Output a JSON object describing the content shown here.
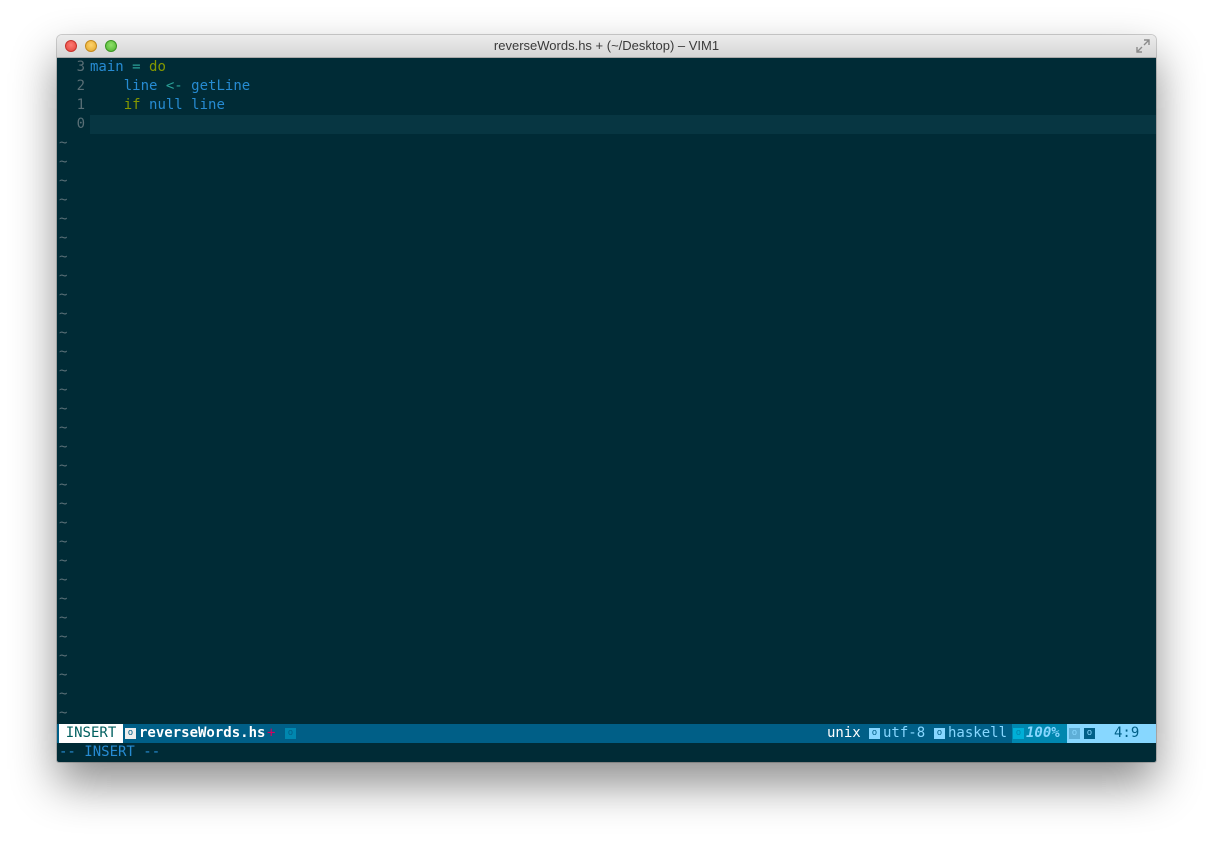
{
  "window": {
    "title": "reverseWords.hs + (~/Desktop) – VIM1"
  },
  "editor": {
    "lines": [
      {
        "num": "3",
        "tokens": [
          [
            "main",
            "kw-main"
          ],
          [
            " ",
            ""
          ],
          [
            "=",
            "kw-op"
          ],
          [
            " ",
            ""
          ],
          [
            "do",
            "kw-do"
          ]
        ]
      },
      {
        "num": "2",
        "tokens": [
          [
            "    ",
            ""
          ],
          [
            "line",
            "kw-ident"
          ],
          [
            " ",
            ""
          ],
          [
            "<-",
            "kw-op"
          ],
          [
            " ",
            ""
          ],
          [
            "getLine",
            "kw-ident"
          ]
        ]
      },
      {
        "num": "1",
        "tokens": [
          [
            "    ",
            ""
          ],
          [
            "if",
            "kw-if"
          ],
          [
            " ",
            ""
          ],
          [
            "null",
            "kw-ident"
          ],
          [
            " ",
            ""
          ],
          [
            "line",
            "kw-ident"
          ]
        ]
      },
      {
        "num": "0",
        "tokens": []
      }
    ],
    "tilde": "~",
    "tilde_count": 31
  },
  "statusline": {
    "mode": "INSERT",
    "badge": "o",
    "filename": "reverseWords.hs",
    "modified": "+",
    "fileformat": "unix",
    "encoding": "utf-8",
    "filetype": "haskell",
    "percent": "100%",
    "position": "4:9"
  },
  "cmdline": {
    "text": "-- INSERT --"
  },
  "colors": {
    "background": "#002b36",
    "cursorline": "#073642",
    "statusline": "#005f87"
  }
}
